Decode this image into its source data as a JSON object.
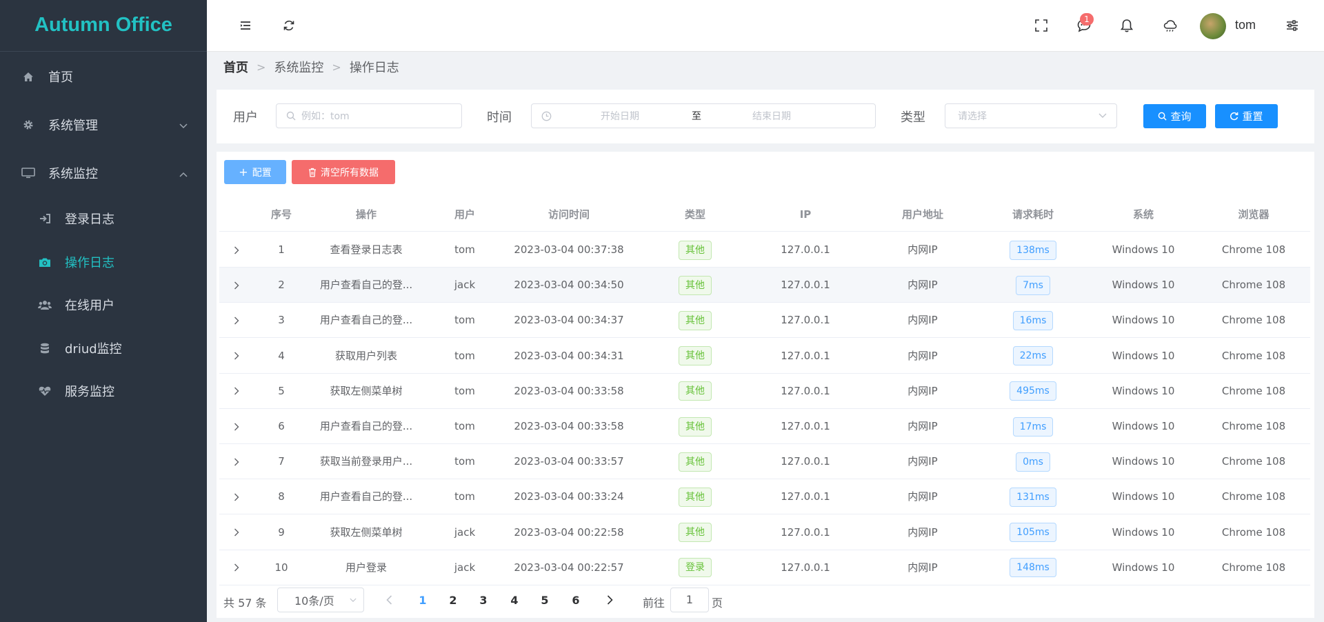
{
  "app": {
    "title": "Autumn Office"
  },
  "sidebar": {
    "items": [
      {
        "label": "首页",
        "icon": "home-icon"
      },
      {
        "label": "系统管理",
        "icon": "gear-icon",
        "expanded": false
      },
      {
        "label": "系统监控",
        "icon": "monitor-icon",
        "expanded": true
      },
      {
        "label": "登录日志",
        "icon": "sign-in-icon"
      },
      {
        "label": "操作日志",
        "icon": "camera-icon",
        "active": true
      },
      {
        "label": "在线用户",
        "icon": "users-icon"
      },
      {
        "label": "driud监控",
        "icon": "database-icon"
      },
      {
        "label": "服务监控",
        "icon": "heartbeat-icon"
      }
    ]
  },
  "header": {
    "notification_count": "1",
    "username": "tom"
  },
  "breadcrumb": {
    "home": "首页",
    "level1": "系统监控",
    "level2": "操作日志"
  },
  "search": {
    "user_label": "用户",
    "user_placeholder": "例如：tom",
    "time_label": "时间",
    "start_placeholder": "开始日期",
    "range_separator": "至",
    "end_placeholder": "结束日期",
    "type_label": "类型",
    "type_placeholder": "请选择",
    "query_button": "查询",
    "reset_button": "重置"
  },
  "toolbar": {
    "config_button": "配置",
    "clear_button": "清空所有数据"
  },
  "table": {
    "headers": {
      "index": "序号",
      "operation": "操作",
      "user": "用户",
      "time": "访问时间",
      "type": "类型",
      "ip": "IP",
      "address": "用户地址",
      "duration": "请求耗时",
      "os": "系统",
      "browser": "浏览器"
    },
    "rows": [
      {
        "index": "1",
        "operation": "查看登录日志表",
        "user": "tom",
        "time": "2023-03-04 00:37:38",
        "type": "其他",
        "ip": "127.0.0.1",
        "address": "内网IP",
        "duration": "138ms",
        "os": "Windows 10",
        "browser": "Chrome 108"
      },
      {
        "index": "2",
        "operation": "用户查看自己的登...",
        "user": "jack",
        "time": "2023-03-04 00:34:50",
        "type": "其他",
        "ip": "127.0.0.1",
        "address": "内网IP",
        "duration": "7ms",
        "os": "Windows 10",
        "browser": "Chrome 108"
      },
      {
        "index": "3",
        "operation": "用户查看自己的登...",
        "user": "tom",
        "time": "2023-03-04 00:34:37",
        "type": "其他",
        "ip": "127.0.0.1",
        "address": "内网IP",
        "duration": "16ms",
        "os": "Windows 10",
        "browser": "Chrome 108"
      },
      {
        "index": "4",
        "operation": "获取用户列表",
        "user": "tom",
        "time": "2023-03-04 00:34:31",
        "type": "其他",
        "ip": "127.0.0.1",
        "address": "内网IP",
        "duration": "22ms",
        "os": "Windows 10",
        "browser": "Chrome 108"
      },
      {
        "index": "5",
        "operation": "获取左侧菜单树",
        "user": "tom",
        "time": "2023-03-04 00:33:58",
        "type": "其他",
        "ip": "127.0.0.1",
        "address": "内网IP",
        "duration": "495ms",
        "os": "Windows 10",
        "browser": "Chrome 108"
      },
      {
        "index": "6",
        "operation": "用户查看自己的登...",
        "user": "tom",
        "time": "2023-03-04 00:33:58",
        "type": "其他",
        "ip": "127.0.0.1",
        "address": "内网IP",
        "duration": "17ms",
        "os": "Windows 10",
        "browser": "Chrome 108"
      },
      {
        "index": "7",
        "operation": "获取当前登录用户...",
        "user": "tom",
        "time": "2023-03-04 00:33:57",
        "type": "其他",
        "ip": "127.0.0.1",
        "address": "内网IP",
        "duration": "0ms",
        "os": "Windows 10",
        "browser": "Chrome 108"
      },
      {
        "index": "8",
        "operation": "用户查看自己的登...",
        "user": "tom",
        "time": "2023-03-04 00:33:24",
        "type": "其他",
        "ip": "127.0.0.1",
        "address": "内网IP",
        "duration": "131ms",
        "os": "Windows 10",
        "browser": "Chrome 108"
      },
      {
        "index": "9",
        "operation": "获取左侧菜单树",
        "user": "jack",
        "time": "2023-03-04 00:22:58",
        "type": "其他",
        "ip": "127.0.0.1",
        "address": "内网IP",
        "duration": "105ms",
        "os": "Windows 10",
        "browser": "Chrome 108"
      },
      {
        "index": "10",
        "operation": "用户登录",
        "user": "jack",
        "time": "2023-03-04 00:22:57",
        "type": "登录",
        "ip": "127.0.0.1",
        "address": "内网IP",
        "duration": "148ms",
        "os": "Windows 10",
        "browser": "Chrome 108"
      }
    ]
  },
  "pagination": {
    "total": "共 57 条",
    "page_size": "10条/页",
    "pages": [
      "1",
      "2",
      "3",
      "4",
      "5",
      "6"
    ],
    "current": "1",
    "goto_label": "前往",
    "goto_value": "1",
    "goto_suffix": "页"
  },
  "colors": {
    "sidebar_bg": "#2b3440",
    "accent": "#22c1c3",
    "primary": "#1890ff",
    "danger": "#f56c6c",
    "success": "#67c23a"
  }
}
